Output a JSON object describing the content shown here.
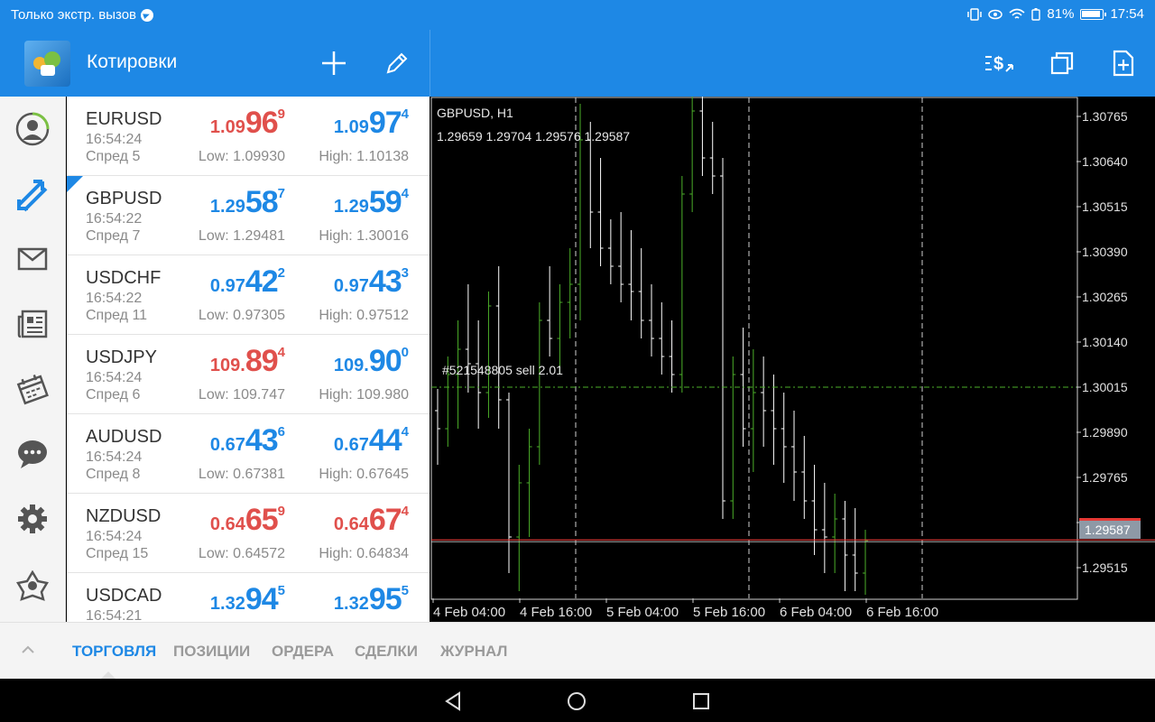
{
  "status_bar": {
    "carrier_text": "Только экстр. вызов",
    "battery": "81%",
    "time": "17:54"
  },
  "header": {
    "title": "Котировки",
    "icons": [
      "add-icon",
      "edit-icon",
      "trade-currency-icon",
      "windows-icon",
      "new-document-icon"
    ]
  },
  "colors": {
    "accent": "#1E88E5",
    "up": "#1E88E5",
    "down": "#E0504C",
    "candle_bull": "#4CAF2A",
    "candle_bear": "#FFFFFF",
    "bid_line": "#E53935",
    "order_line": "#4CAF2A"
  },
  "side_nav": [
    "account-icon",
    "quotes-icon",
    "mail-icon",
    "news-icon",
    "tradays-icon",
    "chat-icon",
    "settings-icon",
    "community-icon"
  ],
  "quotes": [
    {
      "symbol": "EURUSD",
      "time": "16:54:24",
      "spread": "Спред 5",
      "bid": {
        "small": "1.09",
        "big": "96",
        "sup": "9",
        "dir": "down"
      },
      "ask": {
        "small": "1.09",
        "big": "97",
        "sup": "4",
        "dir": "up"
      },
      "low": "Low: 1.09930",
      "high": "High: 1.10138"
    },
    {
      "symbol": "GBPUSD",
      "time": "16:54:22",
      "spread": "Спред 7",
      "bid": {
        "small": "1.29",
        "big": "58",
        "sup": "7",
        "dir": "up"
      },
      "ask": {
        "small": "1.29",
        "big": "59",
        "sup": "4",
        "dir": "up"
      },
      "low": "Low: 1.29481",
      "high": "High: 1.30016"
    },
    {
      "symbol": "USDCHF",
      "time": "16:54:22",
      "spread": "Спред 11",
      "bid": {
        "small": "0.97",
        "big": "42",
        "sup": "2",
        "dir": "up"
      },
      "ask": {
        "small": "0.97",
        "big": "43",
        "sup": "3",
        "dir": "up"
      },
      "low": "Low: 0.97305",
      "high": "High: 0.97512"
    },
    {
      "symbol": "USDJPY",
      "time": "16:54:24",
      "spread": "Спред 6",
      "bid": {
        "small": "109.",
        "big": "89",
        "sup": "4",
        "dir": "down"
      },
      "ask": {
        "small": "109.",
        "big": "90",
        "sup": "0",
        "dir": "up"
      },
      "low": "Low: 109.747",
      "high": "High: 109.980"
    },
    {
      "symbol": "AUDUSD",
      "time": "16:54:24",
      "spread": "Спред 8",
      "bid": {
        "small": "0.67",
        "big": "43",
        "sup": "6",
        "dir": "up"
      },
      "ask": {
        "small": "0.67",
        "big": "44",
        "sup": "4",
        "dir": "up"
      },
      "low": "Low: 0.67381",
      "high": "High: 0.67645"
    },
    {
      "symbol": "NZDUSD",
      "time": "16:54:24",
      "spread": "Спред 15",
      "bid": {
        "small": "0.64",
        "big": "65",
        "sup": "9",
        "dir": "down"
      },
      "ask": {
        "small": "0.64",
        "big": "67",
        "sup": "4",
        "dir": "down"
      },
      "low": "Low: 0.64572",
      "high": "High: 0.64834"
    },
    {
      "symbol": "USDCAD",
      "time": "16:54:21",
      "spread": "",
      "bid": {
        "small": "1.32",
        "big": "94",
        "sup": "5",
        "dir": "up"
      },
      "ask": {
        "small": "1.32",
        "big": "95",
        "sup": "5",
        "dir": "up"
      },
      "low": "",
      "high": ""
    }
  ],
  "chart": {
    "symbol_tf": "GBPUSD, H1",
    "ohlc": "1.29659 1.29704 1.29576 1.29587",
    "order_label": "#521548805 sell 2.01",
    "current_price": "1.29587",
    "y_ticks": [
      "1.30765",
      "1.30640",
      "1.30515",
      "1.30390",
      "1.30265",
      "1.30140",
      "1.30015",
      "1.29890",
      "1.29765",
      "1.29640",
      "1.29515"
    ],
    "x_ticks": [
      "4 Feb 04:00",
      "4 Feb 16:00",
      "5 Feb 04:00",
      "5 Feb 16:00",
      "6 Feb 04:00",
      "6 Feb 16:00"
    ]
  },
  "chart_data": {
    "type": "candlestick",
    "title": "GBPUSD, H1",
    "xlabel": "",
    "ylabel": "",
    "ylim": [
      1.2943,
      1.3082
    ],
    "order_level": 1.30015,
    "bid_level": 1.29587,
    "candles": [
      [
        1.2995,
        1.3001,
        1.298,
        1.299
      ],
      [
        1.299,
        1.301,
        1.2985,
        1.3005
      ],
      [
        1.3005,
        1.302,
        1.299,
        1.3012
      ],
      [
        1.3012,
        1.303,
        1.3,
        1.3008
      ],
      [
        1.3008,
        1.302,
        1.299,
        1.3
      ],
      [
        1.3,
        1.3028,
        1.2993,
        1.3024
      ],
      [
        1.3024,
        1.3035,
        1.299,
        1.2998
      ],
      [
        1.2998,
        1.3,
        1.295,
        1.296
      ],
      [
        1.296,
        1.298,
        1.2945,
        1.2975
      ],
      [
        1.2975,
        1.299,
        1.296,
        1.2985
      ],
      [
        1.2985,
        1.3025,
        1.298,
        1.302
      ],
      [
        1.302,
        1.3035,
        1.301,
        1.3015
      ],
      [
        1.3015,
        1.303,
        1.3005,
        1.3025
      ],
      [
        1.3025,
        1.304,
        1.3015,
        1.303
      ],
      [
        1.303,
        1.308,
        1.302,
        1.307
      ],
      [
        1.307,
        1.3075,
        1.304,
        1.305
      ],
      [
        1.305,
        1.3065,
        1.3035,
        1.304
      ],
      [
        1.304,
        1.3048,
        1.303,
        1.3035
      ],
      [
        1.3035,
        1.305,
        1.3025,
        1.303
      ],
      [
        1.303,
        1.3045,
        1.302,
        1.3028
      ],
      [
        1.3028,
        1.304,
        1.3015,
        1.302
      ],
      [
        1.302,
        1.303,
        1.301,
        1.3015
      ],
      [
        1.3015,
        1.3025,
        1.3005,
        1.301
      ],
      [
        1.301,
        1.302,
        1.3,
        1.3005
      ],
      [
        1.3005,
        1.306,
        1.3,
        1.3055
      ],
      [
        1.3055,
        1.3085,
        1.305,
        1.3078
      ],
      [
        1.3078,
        1.3082,
        1.306,
        1.3065
      ],
      [
        1.3065,
        1.3075,
        1.3055,
        1.306
      ],
      [
        1.306,
        1.3065,
        1.2965,
        1.297
      ],
      [
        1.297,
        1.301,
        1.2965,
        1.3005
      ],
      [
        1.3005,
        1.3018,
        1.2985,
        1.299
      ],
      [
        1.299,
        1.3012,
        1.2978,
        1.3
      ],
      [
        1.3,
        1.301,
        1.2985,
        1.2995
      ],
      [
        1.2995,
        1.3005,
        1.298,
        1.299
      ],
      [
        1.299,
        1.3,
        1.2975,
        1.2985
      ],
      [
        1.2985,
        1.2995,
        1.297,
        1.2978
      ],
      [
        1.2978,
        1.2988,
        1.2965,
        1.297
      ],
      [
        1.297,
        1.298,
        1.2955,
        1.2962
      ],
      [
        1.2962,
        1.2975,
        1.295,
        1.296
      ],
      [
        1.296,
        1.2972,
        1.295,
        1.2965
      ],
      [
        1.2965,
        1.297,
        1.2945,
        1.2955
      ],
      [
        1.2955,
        1.2968,
        1.2945,
        1.295
      ],
      [
        1.295,
        1.2962,
        1.2944,
        1.2959
      ]
    ]
  },
  "bottom_tabs": [
    "ТОРГОВЛЯ",
    "ПОЗИЦИИ",
    "ОРДЕРА",
    "СДЕЛКИ",
    "ЖУРНАЛ"
  ]
}
